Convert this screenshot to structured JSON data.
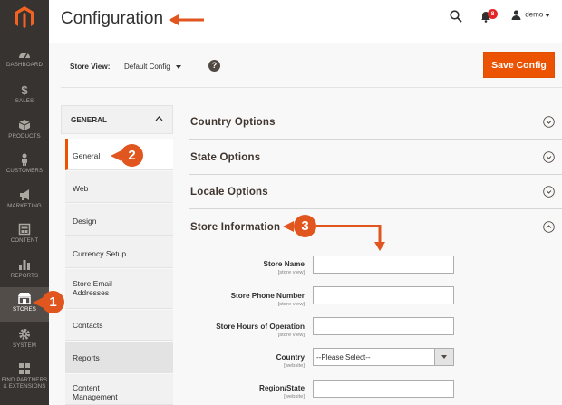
{
  "nav": {
    "items": [
      {
        "label": "DASHBOARD",
        "icon": "dashboard-icon"
      },
      {
        "label": "SALES",
        "icon": "dollar-icon"
      },
      {
        "label": "PRODUCTS",
        "icon": "cube-icon"
      },
      {
        "label": "CUSTOMERS",
        "icon": "person-icon"
      },
      {
        "label": "MARKETING",
        "icon": "megaphone-icon"
      },
      {
        "label": "CONTENT",
        "icon": "layout-icon"
      },
      {
        "label": "REPORTS",
        "icon": "bar-chart-icon"
      },
      {
        "label": "STORES",
        "icon": "store-icon"
      },
      {
        "label": "SYSTEM",
        "icon": "gear-icon"
      },
      {
        "label": "FIND PARTNERS",
        "label2": "& EXTENSIONS",
        "icon": "partners-icon"
      }
    ]
  },
  "header": {
    "title": "Configuration",
    "notifications_count": "8",
    "user_name": "demo"
  },
  "scope": {
    "label": "Store View:",
    "selected": "Default Config",
    "help": "?",
    "save_label": "Save Config"
  },
  "tabs": {
    "group_title": "GENERAL",
    "items": [
      {
        "label": "General"
      },
      {
        "label": "Web"
      },
      {
        "label": "Design"
      },
      {
        "label": "Currency Setup"
      },
      {
        "label": "Store Email",
        "label2": "Addresses"
      },
      {
        "label": "Contacts"
      },
      {
        "label": "Reports"
      },
      {
        "label": "Content",
        "label2": "Management"
      }
    ]
  },
  "sections": [
    {
      "title": "Country Options"
    },
    {
      "title": "State Options"
    },
    {
      "title": "Locale Options"
    },
    {
      "title": "Store Information"
    }
  ],
  "store_info_fields": [
    {
      "label": "Store Name",
      "scope": "[store view]",
      "value": ""
    },
    {
      "label": "Store Phone Number",
      "scope": "[store view]",
      "value": ""
    },
    {
      "label": "Store Hours of Operation",
      "scope": "[store view]",
      "value": ""
    },
    {
      "label": "Country",
      "scope": "[website]",
      "selected": "--Please Select--"
    },
    {
      "label": "Region/State",
      "scope": "[website]",
      "value": ""
    }
  ],
  "callouts": [
    "1",
    "2",
    "3"
  ],
  "colors": {
    "accent": "#eb5202",
    "callout": "#e1561e",
    "nav_bg": "#373330"
  }
}
